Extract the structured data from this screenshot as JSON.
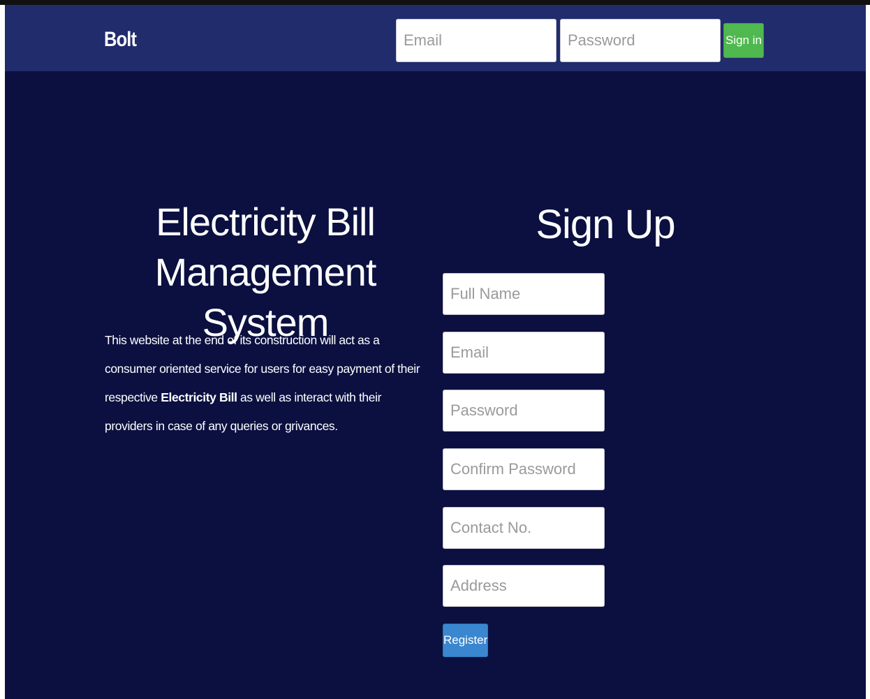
{
  "navbar": {
    "brand": "Bolt",
    "email_placeholder": "Email",
    "password_placeholder": "Password",
    "signin_label": "Sign in"
  },
  "hero": {
    "title_line1": "Electricity Bill",
    "title_line2": "Management System",
    "desc_part1": "This website at the end of its construction will act as a consumer oriented service for users for easy payment of their respective ",
    "desc_bold": "Electricity Bill",
    "desc_part2": " as well as interact with their providers in case of any queries or grivances."
  },
  "signup": {
    "title": "Sign Up",
    "full_name_placeholder": "Full Name",
    "email_placeholder": "Email",
    "password_placeholder": "Password",
    "confirm_password_placeholder": "Confirm Password",
    "contact_placeholder": "Contact No.",
    "address_placeholder": "Address",
    "register_label": "Register"
  },
  "colors": {
    "background": "#0b1040",
    "navbar": "#202c6b",
    "signin_button": "#4fb84f",
    "register_button": "#3a87cf"
  }
}
